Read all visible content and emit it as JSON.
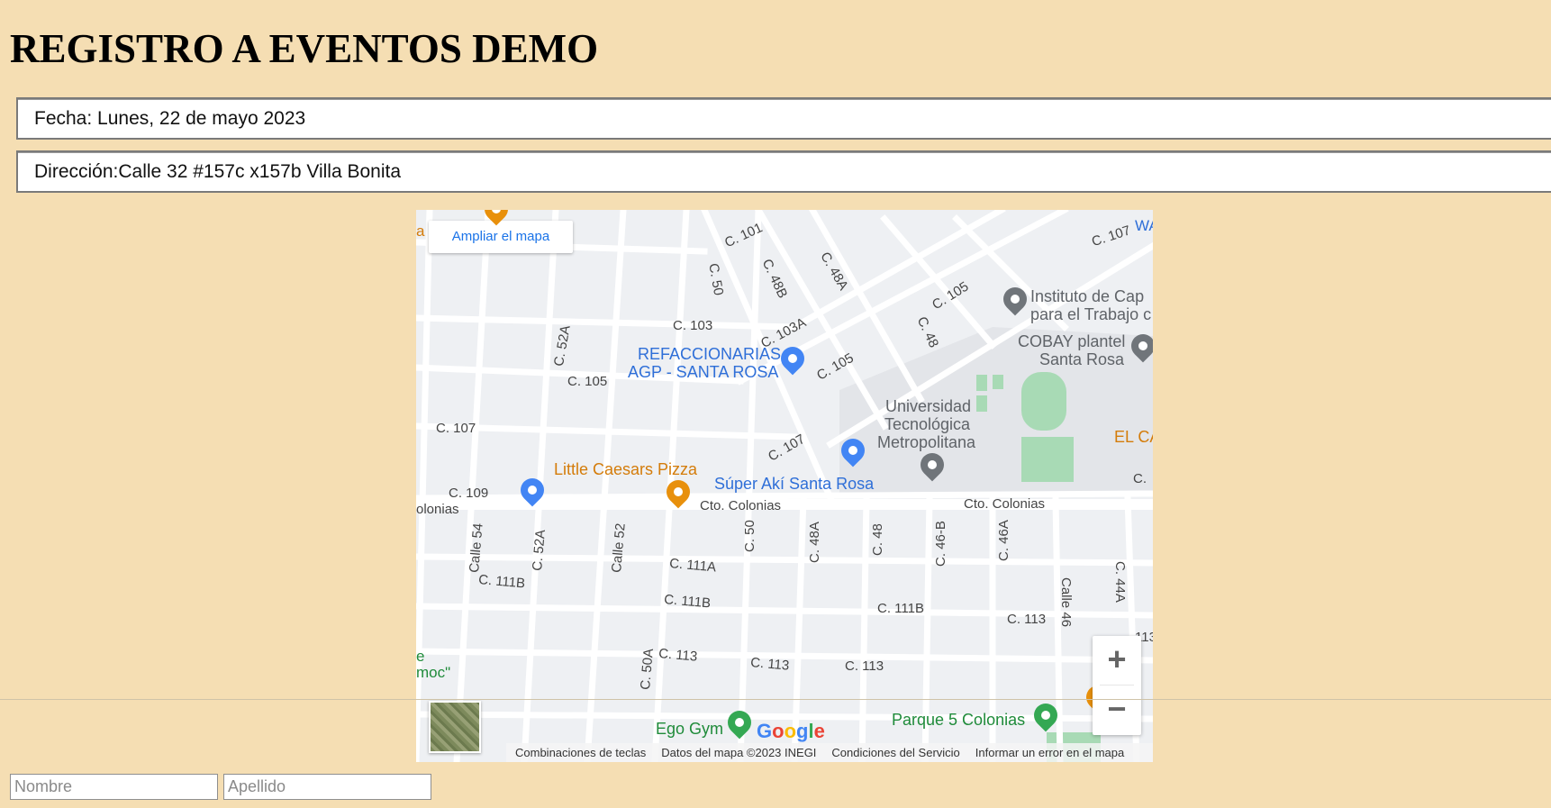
{
  "page": {
    "title": "REGISTRO A EVENTOS DEMO"
  },
  "event": {
    "fecha": "Fecha: Lunes, 22 de mayo 2023",
    "direccion": "Dirección:Calle 32 #157c x157b Villa Bonita"
  },
  "map": {
    "expand_label": "Ampliar el mapa",
    "zoom_in": "+",
    "zoom_out": "−",
    "google_logo": [
      "G",
      "o",
      "o",
      "g",
      "l",
      "e"
    ],
    "streets": {
      "c101": "C. 101",
      "c107_tr": "C. 107",
      "c50_top": "C. 50",
      "c48b": "C. 48B",
      "c48a_top": "C. 48A",
      "c105_tr": "C. 105",
      "c103": "C. 103",
      "c103a": "C. 103A",
      "c48_top": "C. 48",
      "c52a_top": "C. 52A",
      "c105_mid": "C. 105",
      "c105_left": "C. 105",
      "c107_left": "C. 107",
      "c107_mid": "C. 107",
      "c109": "C. 109",
      "colonias_left": "olonias",
      "cto_colonias_1": "Cto. Colonias",
      "cto_colonias_2": "Cto. Colonias",
      "calle54": "Calle 54",
      "c52a_bot": "C. 52A",
      "calle52": "Calle 52",
      "c50_bot": "C. 50",
      "c48a_bot": "C. 48A",
      "c48_bot": "C. 48",
      "c46b": "C. 46-B",
      "c46a": "C. 46A",
      "c44a": "C. 44A",
      "c111a": "C. 111A",
      "c111b_left": "C. 111B",
      "c111b_mid": "C. 111B",
      "c111b_right": "C. 111B",
      "calle46": "Calle 46",
      "c113_right": "C. 113",
      "c50a": "C. 50A",
      "c113_1": "C. 113",
      "c113_2": "C. 113",
      "c113_3": "C. 113",
      "edge_c": "C.",
      "edge_113": "113",
      "edge_wa": "WA",
      "edge_a": "a",
      "edge_moc": "moc\"",
      "edge_e": "e"
    },
    "pois": {
      "refaccionarias_1": "REFACCIONARIAS",
      "refaccionarias_2": "AGP - SANTA ROSA",
      "instituto_1": "Instituto de Cap",
      "instituto_2": "para el Trabajo c",
      "cobay_1": "COBAY plantel",
      "cobay_2": "Santa Rosa",
      "universidad_1": "Universidad",
      "universidad_2": "Tecnológica",
      "universidad_3": "Metropolitana",
      "el_ca": "EL CA",
      "little_caesars": "Little Caesars Pizza",
      "super_aki": "Súper Akí Santa Rosa",
      "ego_gym": "Ego Gym",
      "parque": "Parque 5 Colonias"
    },
    "attribution": [
      "Combinaciones de teclas",
      "Datos del mapa ©2023 INEGI",
      "Condiciones del Servicio",
      "Informar un error en el mapa"
    ]
  },
  "form": {
    "nombre_placeholder": "Nombre",
    "apellido_placeholder": "Apellido"
  },
  "colors": {
    "background": "#f5deb3",
    "poi_blue": "#2f6fd8",
    "poi_orange": "#d47c0a",
    "poi_green": "#1f8b3a"
  }
}
